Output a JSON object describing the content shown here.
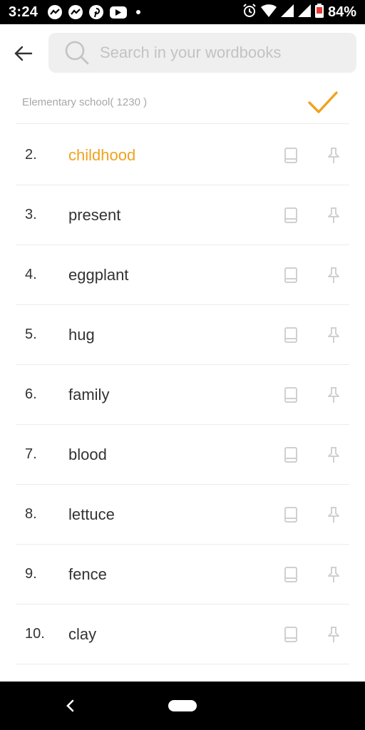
{
  "status_bar": {
    "time": "3:24",
    "battery": "84%",
    "left_icons": [
      "messenger-icon",
      "messenger-icon",
      "pinterest-icon",
      "youtube-icon",
      "dot-icon"
    ],
    "right_icons": [
      "alarm-icon",
      "wifi-icon",
      "signal-icon",
      "signal-icon",
      "battery-icon"
    ]
  },
  "header": {
    "back_icon": "arrow-left-icon",
    "search_placeholder": "Search in your wordbooks"
  },
  "book": {
    "label": "Elementary school( 1230 )",
    "check_icon": "checkmark-icon"
  },
  "colors": {
    "accent": "#f0a21e",
    "text": "#333333",
    "muted": "#a8a8a8",
    "icon_gray": "#d0d0d0"
  },
  "words": [
    {
      "num": "2.",
      "word": "childhood",
      "active": true
    },
    {
      "num": "3.",
      "word": "present"
    },
    {
      "num": "4.",
      "word": "eggplant"
    },
    {
      "num": "5.",
      "word": "hug"
    },
    {
      "num": "6.",
      "word": "family"
    },
    {
      "num": "7.",
      "word": "blood"
    },
    {
      "num": "8.",
      "word": "lettuce"
    },
    {
      "num": "9.",
      "word": "fence"
    },
    {
      "num": "10.",
      "word": "clay"
    }
  ],
  "nav": {
    "back_icon": "chevron-left-icon",
    "home_icon": "home-pill-icon"
  }
}
